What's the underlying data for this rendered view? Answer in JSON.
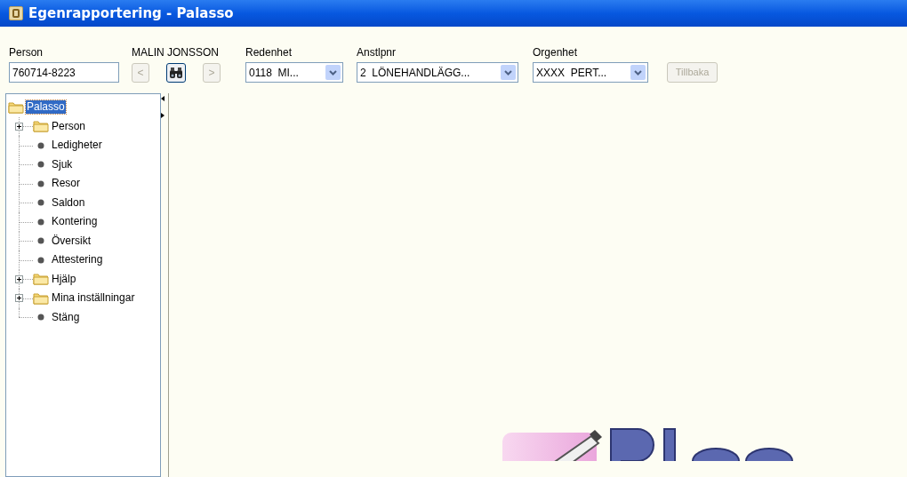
{
  "window": {
    "title": "Egenrapportering - Palasso"
  },
  "person": {
    "label": "Person",
    "value": "760714-8223",
    "name": "MALIN JONSSON"
  },
  "nav_buttons": [
    {
      "label": "<",
      "disabled": true
    },
    {
      "kind": "search",
      "disabled": false
    },
    {
      "label": ">",
      "disabled": true
    }
  ],
  "dropdowns": [
    {
      "label": "Redenhet",
      "value": "0118  MI..."
    },
    {
      "label": "Anstlpnr",
      "value": "2  LÖNEHANDLÄGG..."
    },
    {
      "label": "Orgenhet",
      "value": "XXXX  PERT..."
    }
  ],
  "back_button": {
    "label": "Tillbaka",
    "disabled": true
  },
  "tree": {
    "label": "Palasso",
    "kind": "folder",
    "selected": true,
    "expanded": true,
    "children": [
      {
        "label": "Person",
        "kind": "folder",
        "expanded": false,
        "selected": false
      },
      {
        "label": "Ledigheter",
        "kind": "leaf",
        "selected": false
      },
      {
        "label": "Sjuk",
        "kind": "leaf",
        "selected": false
      },
      {
        "label": "Resor",
        "kind": "leaf",
        "selected": false
      },
      {
        "label": "Saldon",
        "kind": "leaf",
        "selected": false
      },
      {
        "label": "Kontering",
        "kind": "leaf",
        "selected": false
      },
      {
        "label": "Översikt",
        "kind": "leaf",
        "selected": false
      },
      {
        "label": "Attestering",
        "kind": "leaf",
        "selected": false
      },
      {
        "label": "Hjälp",
        "kind": "folder",
        "expanded": false,
        "selected": false
      },
      {
        "label": "Mina inställningar",
        "kind": "folder",
        "expanded": false,
        "selected": false
      },
      {
        "label": "Stäng",
        "kind": "leaf",
        "selected": false
      }
    ]
  }
}
